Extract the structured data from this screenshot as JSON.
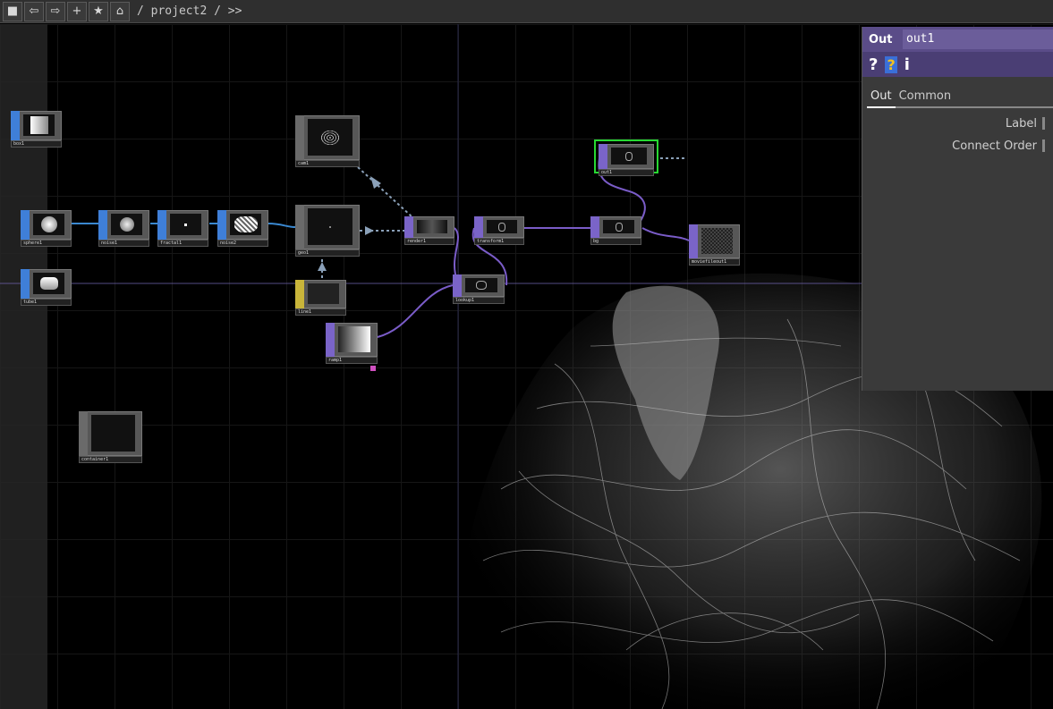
{
  "toolbar": {
    "path": "/ project2 / >>",
    "buttons": [
      "stop-icon",
      "back-icon",
      "forward-icon",
      "add-icon",
      "bookmark-star-icon",
      "home-icon"
    ]
  },
  "nodes": {
    "box1": "box1",
    "sphere1": "sphere1",
    "noise1": "noise1",
    "fractal1": "fractal1",
    "noise2": "noise2",
    "tube1": "tube1",
    "cam1": "cam1",
    "geo1": "geo1",
    "line1": "line1",
    "ramp1": "ramp1",
    "render1": "render1",
    "transform1": "transform1",
    "lookup1": "lookup1",
    "bg": "bg",
    "out1": "out1",
    "moviefileout1": "moviefileout1",
    "container1": "container1"
  },
  "panel": {
    "op_type": "Out",
    "op_name": "out1",
    "icons": [
      "?",
      "?",
      "i"
    ],
    "tabs": [
      "Out",
      "Common"
    ],
    "active_tab": "Out",
    "params": [
      "Label",
      "Connect Order"
    ]
  },
  "colors": {
    "sop_tab": "#3f7fd8",
    "top_tab": "#7a64c8",
    "mat_tab": "#c9b53a",
    "wire_sop": "#3a88d0",
    "wire_top": "#7a5cc8",
    "selected": "#27d832",
    "panel_header": "#5a4c88"
  }
}
